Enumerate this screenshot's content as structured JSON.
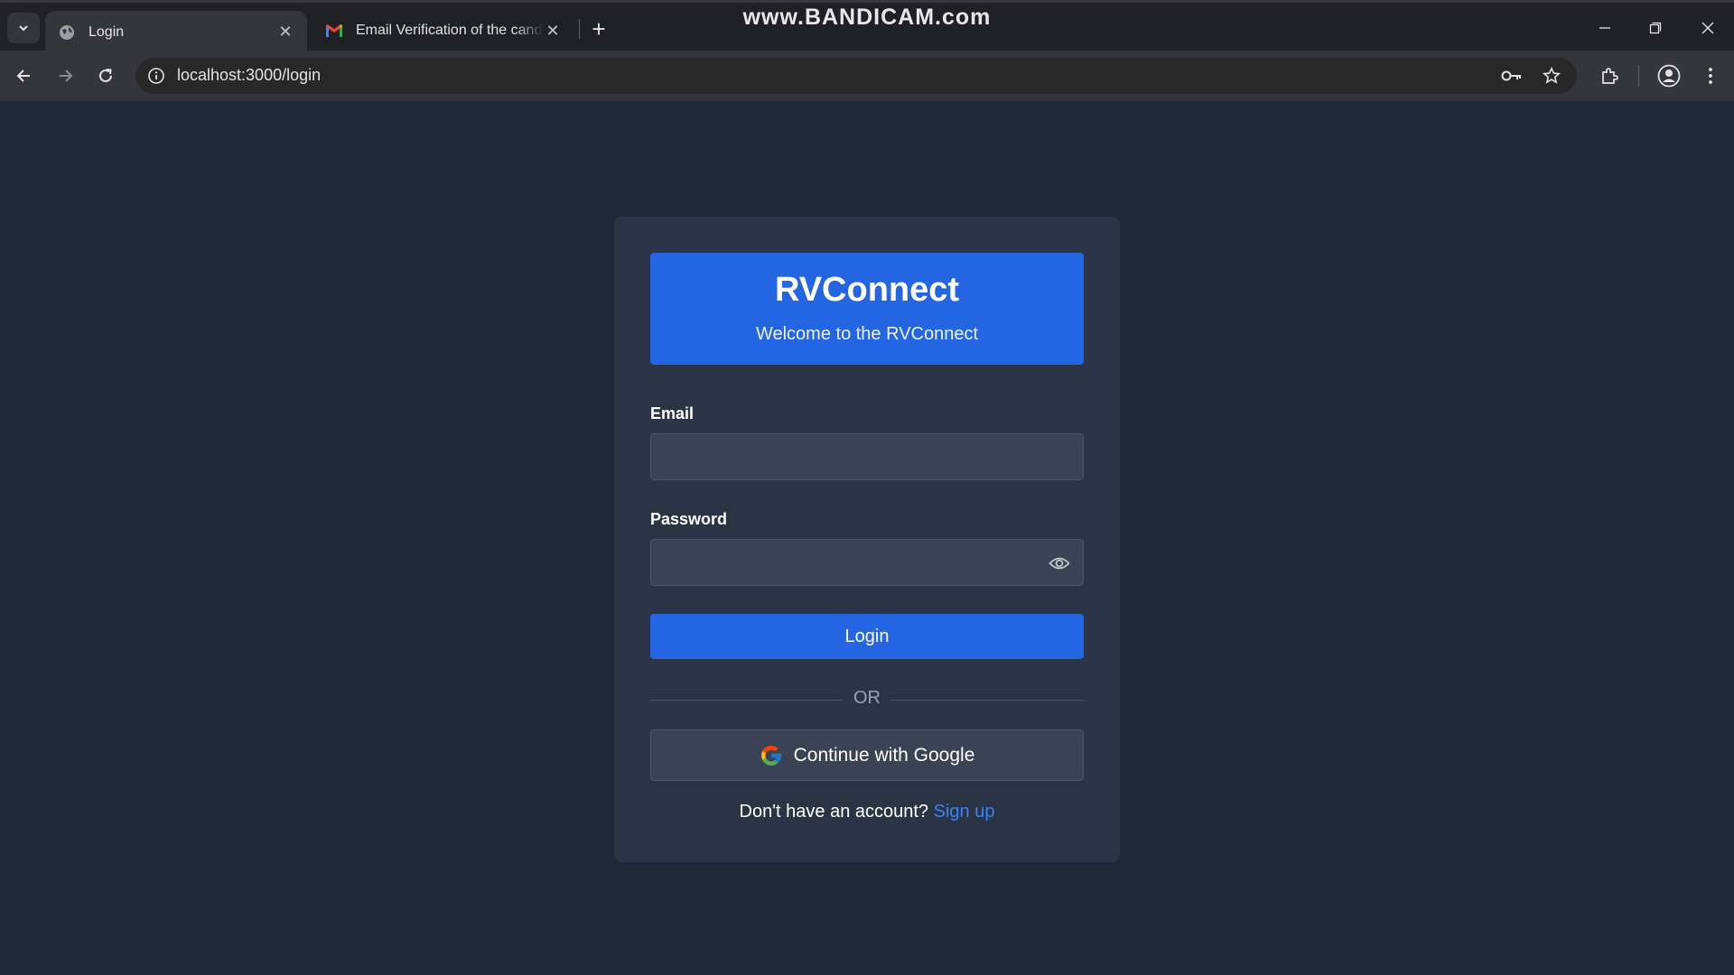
{
  "browser": {
    "tabs": [
      {
        "title": "Login",
        "active": true
      },
      {
        "title": "Email Verification of the candidate",
        "active": false
      }
    ],
    "watermark": "www.BANDICAM.com",
    "url": "localhost:3000/login"
  },
  "login": {
    "brand_title": "RVConnect",
    "brand_subtitle": "Welcome to the RVConnect",
    "email_label": "Email",
    "email_value": "",
    "password_label": "Password",
    "password_value": "",
    "login_button": "Login",
    "divider_text": "OR",
    "google_button": "Continue with Google",
    "signup_prompt": "Don't have an account?",
    "signup_link": "Sign up"
  },
  "colors": {
    "page_bg": "#1f2737",
    "card_bg": "#2a3444",
    "accent": "#2465e1",
    "link": "#3b82f6"
  },
  "icons": [
    "tab-search-icon",
    "globe-icon",
    "gmail-icon",
    "close-icon",
    "plus-icon",
    "minimize-icon",
    "restore-icon",
    "back-arrow-icon",
    "forward-arrow-icon",
    "reload-icon",
    "info-icon",
    "password-key-icon",
    "star-icon",
    "extensions-icon",
    "profile-icon",
    "kebab-menu-icon",
    "eye-icon",
    "google-icon"
  ]
}
